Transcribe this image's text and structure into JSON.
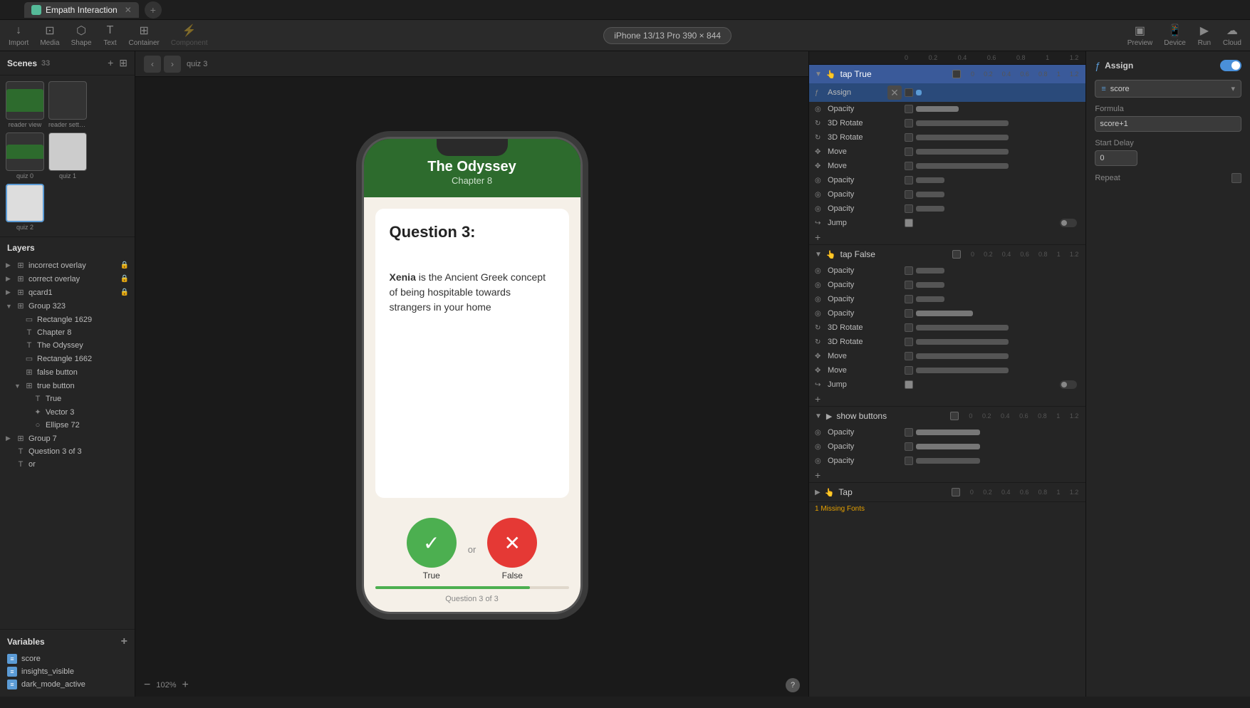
{
  "window": {
    "title": "Empath Interaction",
    "device": "iPhone 13/13 Pro  390 × 844"
  },
  "topbar": {
    "tabs": [
      {
        "label": "Empath Interaction",
        "active": true
      }
    ],
    "actions": [
      "Preview",
      "Device",
      "Run",
      "Cloud"
    ]
  },
  "toolbar": {
    "tools": [
      "Import",
      "Media",
      "Shape",
      "Text",
      "Container",
      "Component"
    ]
  },
  "scenes": {
    "label": "Scenes",
    "count": "33",
    "items": [
      {
        "label": "reader view",
        "type": "preview"
      },
      {
        "label": "reader sett ings",
        "type": "preview"
      },
      {
        "label": "quiz 0",
        "type": "preview"
      },
      {
        "label": "quiz 1",
        "type": "preview"
      },
      {
        "label": "quiz 2",
        "type": "preview",
        "active": true
      }
    ]
  },
  "layers": {
    "label": "Layers",
    "items": [
      {
        "indent": 0,
        "icon": "group",
        "name": "incorrect overlay",
        "lock": true,
        "arrow": "▶",
        "depth": 0
      },
      {
        "indent": 0,
        "icon": "group",
        "name": "correct overlay",
        "lock": true,
        "arrow": "▶",
        "depth": 0
      },
      {
        "indent": 0,
        "icon": "group",
        "name": "qcard1",
        "lock": true,
        "arrow": "▶",
        "depth": 0
      },
      {
        "indent": 0,
        "icon": "group",
        "name": "Group 323",
        "arrow": "▼",
        "depth": 0
      },
      {
        "indent": 1,
        "icon": "rect",
        "name": "Rectangle 1629",
        "depth": 1
      },
      {
        "indent": 1,
        "icon": "text",
        "name": "Chapter 8",
        "depth": 1
      },
      {
        "indent": 1,
        "icon": "text",
        "name": "The Odyssey",
        "depth": 1
      },
      {
        "indent": 1,
        "icon": "rect",
        "name": "Rectangle 1662",
        "depth": 1
      },
      {
        "indent": 1,
        "icon": "group",
        "name": "false button",
        "depth": 1
      },
      {
        "indent": 1,
        "icon": "group",
        "name": "true button",
        "arrow": "▼",
        "depth": 1
      },
      {
        "indent": 2,
        "icon": "text",
        "name": "True",
        "depth": 2
      },
      {
        "indent": 2,
        "icon": "vector",
        "name": "Vector 3",
        "depth": 2
      },
      {
        "indent": 2,
        "icon": "ellipse",
        "name": "Ellipse 72",
        "depth": 2
      },
      {
        "indent": 0,
        "icon": "group",
        "name": "Group 7",
        "arrow": "▶",
        "depth": 0
      },
      {
        "indent": 0,
        "icon": "text",
        "name": "Question 3 of 3",
        "depth": 0
      },
      {
        "indent": 0,
        "icon": "text",
        "name": "or",
        "depth": 0
      }
    ]
  },
  "variables": {
    "label": "Variables",
    "items": [
      {
        "name": "score"
      },
      {
        "name": "insights_visible"
      },
      {
        "name": "dark_mode_active"
      }
    ]
  },
  "canvas": {
    "breadcrumb": "quiz 3",
    "zoom": "102%",
    "nav_back": "‹",
    "nav_forward": "›"
  },
  "phone": {
    "header_title": "The Odyssey",
    "header_subtitle": "Chapter 8",
    "question_title": "Question 3:",
    "question_body_prefix": "Xenia",
    "question_body_suffix": " is the Ancient Greek concept of being hospitable towards strangers in your home",
    "true_label": "True",
    "false_label": "False",
    "or_text": "or",
    "question_counter": "Question 3 of 3",
    "progress_percent": 80
  },
  "interactions": {
    "sections": [
      {
        "id": "tap_true",
        "label": "tap True",
        "active": true,
        "rows": [
          {
            "icon": "opacity",
            "name": "Assign",
            "active": true
          },
          {
            "icon": "opacity",
            "name": "Opacity"
          },
          {
            "icon": "rotate",
            "name": "3D Rotate"
          },
          {
            "icon": "rotate",
            "name": "3D Rotate"
          },
          {
            "icon": "move",
            "name": "Move"
          },
          {
            "icon": "move",
            "name": "Move"
          },
          {
            "icon": "opacity",
            "name": "Opacity"
          },
          {
            "icon": "opacity",
            "name": "Opacity"
          },
          {
            "icon": "opacity",
            "name": "Opacity"
          },
          {
            "icon": "jump",
            "name": "Jump"
          }
        ]
      },
      {
        "id": "tap_false",
        "label": "tap False",
        "active": false,
        "rows": [
          {
            "icon": "opacity",
            "name": "Opacity"
          },
          {
            "icon": "opacity",
            "name": "Opacity"
          },
          {
            "icon": "opacity",
            "name": "Opacity"
          },
          {
            "icon": "opacity",
            "name": "Opacity"
          },
          {
            "icon": "rotate",
            "name": "3D Rotate"
          },
          {
            "icon": "rotate",
            "name": "3D Rotate"
          },
          {
            "icon": "move",
            "name": "Move"
          },
          {
            "icon": "move",
            "name": "Move"
          },
          {
            "icon": "jump",
            "name": "Jump"
          }
        ]
      },
      {
        "id": "show_buttons",
        "label": "show buttons",
        "active": false,
        "rows": [
          {
            "icon": "opacity",
            "name": "Opacity"
          },
          {
            "icon": "opacity",
            "name": "Opacity"
          },
          {
            "icon": "opacity",
            "name": "Opacity"
          }
        ]
      },
      {
        "id": "tap",
        "label": "Tap",
        "active": false,
        "rows": []
      }
    ],
    "timeline_labels": [
      "0",
      "0.2",
      "0.4",
      "0.6",
      "0.8",
      "1",
      "1.2"
    ]
  },
  "properties": {
    "section_label": "Assign",
    "variable_label": "score",
    "formula_label": "Formula",
    "formula_value": "score+1",
    "start_delay_label": "Start Delay",
    "start_delay_value": "0",
    "repeat_label": "Repeat",
    "font_warning": "1 Missing Fonts"
  }
}
